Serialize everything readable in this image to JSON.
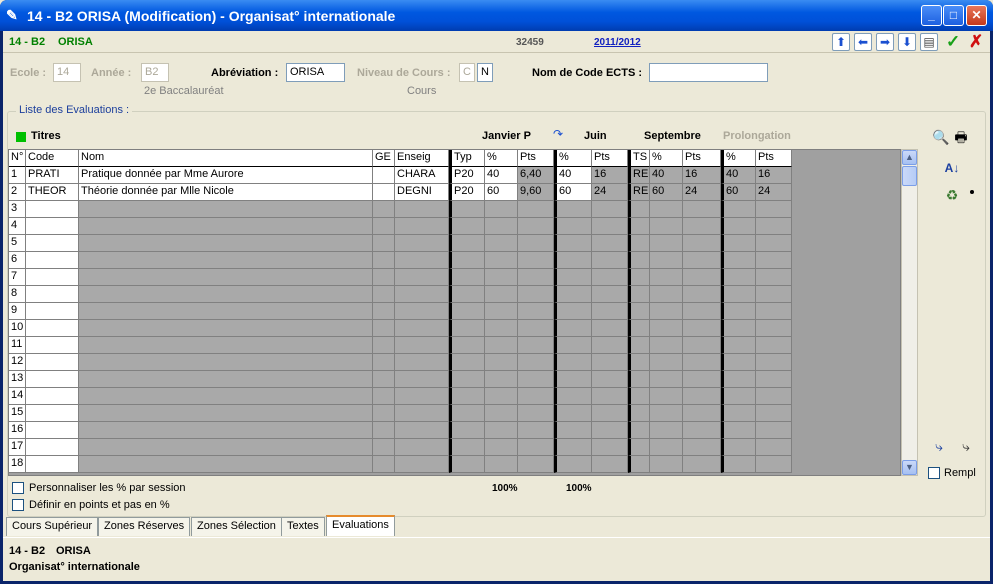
{
  "window": {
    "title": "14 - B2    ORISA (Modification) - Organisat° internationale",
    "minimize": "_",
    "maximize": "□",
    "close": "✕"
  },
  "toprow": {
    "code": "14 - B2",
    "abbr": "ORISA",
    "number": "32459",
    "year_link": "2011/2012"
  },
  "fields": {
    "ecole_label": "Ecole :",
    "ecole_value": "14",
    "annee_label": "Année :",
    "annee_value": "B2",
    "annee_sub": "2e Baccalauréat",
    "abreviation_label": "Abréviation :",
    "abreviation_value": "ORISA",
    "niveau_label": "Niveau de Cours :",
    "niveau_value1": "C",
    "niveau_value2": "N",
    "niveau_sub": "Cours",
    "ects_label": "Nom de Code ECTS :",
    "ects_value": ""
  },
  "evaluations": {
    "legend": "Liste des Evaluations :",
    "titres": "Titres",
    "sessions": {
      "janvier": "Janvier P",
      "juin": "Juin",
      "septembre": "Septembre",
      "prolongation": "Prolongation"
    },
    "columns": [
      "N°",
      "Code",
      "Nom",
      "GE",
      "Enseig",
      "Typ",
      "%",
      "Pts",
      "%",
      "Pts",
      "TS",
      "%",
      "Pts",
      "%",
      "Pts"
    ],
    "rows": [
      {
        "n": "1",
        "code": "PRATI",
        "nom": "Pratique donnée par Mme Aurore",
        "ge": "",
        "enseig": "CHARA",
        "typ": "P20",
        "jp": "40",
        "jpts": "6,40",
        "jup": "40",
        "jupts": "16",
        "ts": "RE",
        "sp": "40",
        "spts": "16",
        "pp": "40",
        "ppts": "16"
      },
      {
        "n": "2",
        "code": "THEOR",
        "nom": "Théorie donnée par Mlle Nicole",
        "ge": "",
        "enseig": "DEGNI",
        "typ": "P20",
        "jp": "60",
        "jpts": "9,60",
        "jup": "60",
        "jupts": "24",
        "ts": "RE",
        "sp": "60",
        "spts": "24",
        "pp": "60",
        "ppts": "24"
      }
    ],
    "empty_rows": [
      "3",
      "4",
      "5",
      "6",
      "7",
      "8",
      "9",
      "10",
      "11",
      "12",
      "13",
      "14",
      "15",
      "16",
      "17",
      "18"
    ],
    "personnaliser": "Personnaliser les % par session",
    "definir": "Définir en points et pas en %",
    "total_janvier": "100%",
    "total_juin": "100%",
    "rempl": "Rempl"
  },
  "tabs": [
    "Cours Supérieur",
    "Zones Réserves",
    "Zones Sélection",
    "Textes",
    "Evaluations"
  ],
  "footer": {
    "line1_code": "14 - B2",
    "line1_abbr": "ORISA",
    "line2": "Organisat° internationale"
  }
}
